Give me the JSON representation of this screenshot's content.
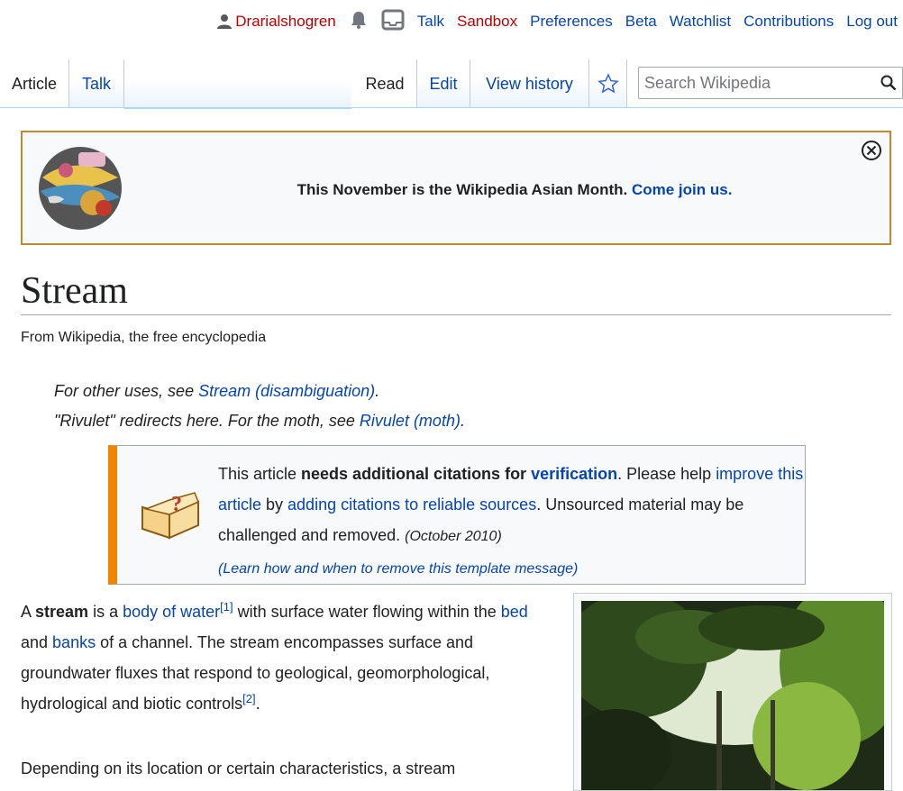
{
  "personal": {
    "username": "Drarialshogren",
    "talk": "Talk",
    "sandbox": "Sandbox",
    "preferences": "Preferences",
    "beta": "Beta",
    "watchlist": "Watchlist",
    "contributions": "Contributions",
    "logout": "Log out"
  },
  "tabs": {
    "article": "Article",
    "talk": "Talk",
    "read": "Read",
    "edit": "Edit",
    "history": "View history"
  },
  "search": {
    "placeholder": "Search Wikipedia"
  },
  "banner": {
    "text": "This November is the Wikipedia Asian Month.",
    "link": "Come join us."
  },
  "page": {
    "title": "Stream",
    "tagline": "From Wikipedia, the free encyclopedia"
  },
  "hatnotes": {
    "h1_pre": "For other uses, see ",
    "h1_link": "Stream (disambiguation)",
    "h1_post": ".",
    "h2_pre": "\"Rivulet\" redirects here. For the moth, see ",
    "h2_link": "Rivulet (moth)",
    "h2_post": "."
  },
  "ambox": {
    "t1": "This article ",
    "t2": "needs additional citations for ",
    "t3": "verification",
    "t4": ". Please help ",
    "t5": "improve this article",
    "t6": " by ",
    "t7": "adding citations to reliable sources",
    "t8": ". Unsourced material may be challenged and removed.",
    "date": "(October 2010)",
    "learn": "(Learn how and when to remove this template message)"
  },
  "body": {
    "p1_a": "A ",
    "p1_b": "stream",
    "p1_c": " is a ",
    "p1_link1": "body of water",
    "p1_ref1": "[1]",
    "p1_d": " with surface water flowing within the ",
    "p1_link2": "bed",
    "p1_e": " and ",
    "p1_link3": "banks",
    "p1_f": " of a channel. The stream encompasses surface and groundwater fluxes that respond to geological, geomorphological, hydrological and biotic controls",
    "p1_ref2": "[2]",
    "p1_g": ".",
    "p2": "Depending on its location or certain characteristics, a stream"
  }
}
